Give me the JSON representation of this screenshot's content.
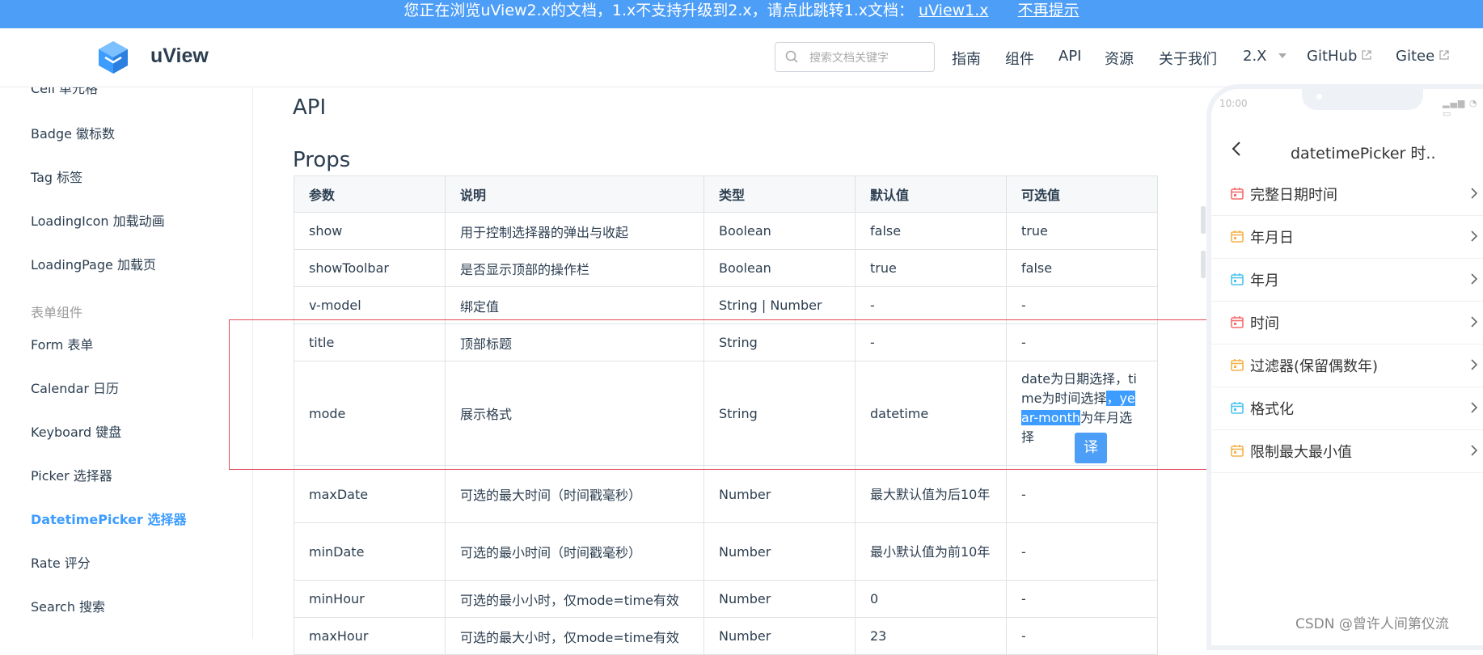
{
  "banner": {
    "message": "您正在浏览uView2.x的文档，1.x不支持升级到2.x，请点此跳转1.x文档：",
    "link_v1": "uView1.x",
    "link_dismiss": "不再提示"
  },
  "navbar": {
    "brand": "uView",
    "search_placeholder": "搜索文档关键字",
    "items": [
      "指南",
      "组件",
      "API",
      "资源",
      "关于我们"
    ],
    "version": "2.X",
    "github": "GitHub",
    "gitee": "Gitee"
  },
  "sidebar": {
    "items_top": [
      "Cell 单元格",
      "Badge 徽标数",
      "Tag 标签",
      "LoadingIcon 加载动画",
      "LoadingPage 加载页"
    ],
    "group_title": "表单组件",
    "items_form": [
      "Form 表单",
      "Calendar 日历",
      "Keyboard 键盘",
      "Picker 选择器",
      "DatetimePicker 选择器",
      "Rate 评分",
      "Search 搜索"
    ],
    "active_item": "DatetimePicker 选择器"
  },
  "main": {
    "heading_api": "API",
    "heading_props": "Props",
    "table": {
      "headers": [
        "参数",
        "说明",
        "类型",
        "默认值",
        "可选值"
      ],
      "rows": [
        [
          "show",
          "用于控制选择器的弹出与收起",
          "Boolean",
          "false",
          "true"
        ],
        [
          "showToolbar",
          "是否显示顶部的操作栏",
          "Boolean",
          "true",
          "false"
        ],
        [
          "v-model",
          "绑定值",
          "String | Number",
          "-",
          "-"
        ],
        [
          "title",
          "顶部标题",
          "String",
          "-",
          "-"
        ],
        [
          "mode",
          "展示格式",
          "String",
          "datetime",
          ""
        ],
        [
          "maxDate",
          "可选的最大时间（时间戳毫秒）",
          "Number",
          "最大默认值为后10年",
          "-"
        ],
        [
          "minDate",
          "可选的最小时间（时间戳毫秒）",
          "Number",
          "最小默认值为前10年",
          "-"
        ],
        [
          "minHour",
          "可选的最小小时，仅mode=time有效",
          "Number",
          "0",
          "-"
        ],
        [
          "maxHour",
          "可选的最大小时，仅mode=time有效",
          "Number",
          "23",
          "-"
        ]
      ],
      "mode_options": {
        "line1": "date为日期选择，ti",
        "line2_a": "me为时间选择",
        "line2_b": "，ye",
        "line3_a": "ar-month",
        "line3_b": "为年月选",
        "line4": "择"
      }
    },
    "translate_button": "译"
  },
  "phone": {
    "time": "10:00",
    "title": "datetimePicker 时..",
    "items": [
      {
        "label": "完整日期时间",
        "icon_color": "#f56c6c"
      },
      {
        "label": "年月日",
        "icon_color": "#f3b24a"
      },
      {
        "label": "年月",
        "icon_color": "#4cc3ec"
      },
      {
        "label": "时间",
        "icon_color": "#f56c6c"
      },
      {
        "label": "过滤器(保留偶数年)",
        "icon_color": "#f3b24a"
      },
      {
        "label": "格式化",
        "icon_color": "#4cc3ec"
      },
      {
        "label": "限制最大最小值",
        "icon_color": "#f3b24a"
      }
    ]
  },
  "watermark": "CSDN @曾许人间第仪流",
  "colors": {
    "accent": "#3c9cff",
    "banner": "#4d9ef7",
    "highlight_box": "#e34d59"
  }
}
